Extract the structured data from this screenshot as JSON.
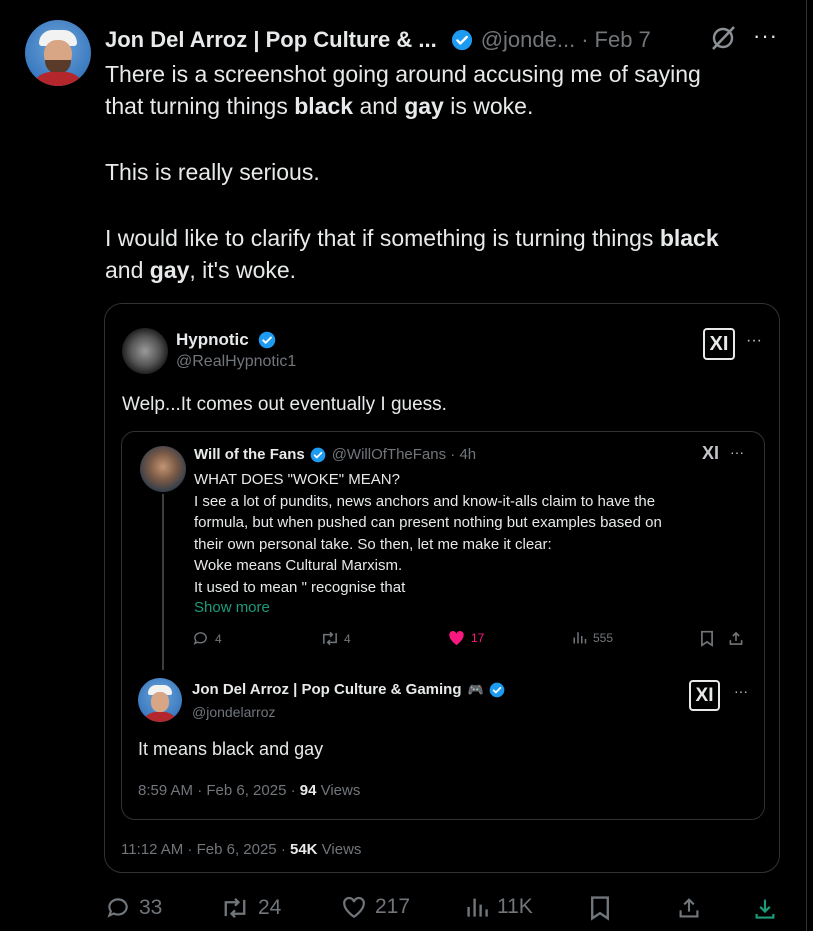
{
  "tweet": {
    "author_name": "Jon Del Arroz | Pop Culture & ...",
    "author_handle": "@jonde...",
    "separator": "·",
    "date": "Feb 7",
    "more": "···",
    "text": {
      "l1_pre": "There is a screenshot going around accusing me of saying",
      "l2_pre": "that turning things ",
      "l2_b1": "black",
      "l2_mid": " and ",
      "l2_b2": "gay",
      "l2_post": " is woke.",
      "p2": "This is really serious.",
      "l5_pre": "I would like to clarify that if something is turning things ",
      "l5_b": "black",
      "l6_mid": "and ",
      "l6_b": "gay",
      "l6_post": ", it's woke."
    }
  },
  "quote": {
    "author_name": "Hypnotic",
    "author_handle": "@RealHypnotic1",
    "xlogo": "XI",
    "more": "···",
    "text": "Welp...It comes out eventually I guess.",
    "nested": {
      "author_name": "Will of the Fans",
      "author_handle": "@WillOfTheFans · 4h",
      "xlogo": "XI",
      "more": "···",
      "lines": [
        "WHAT DOES \"WOKE\" MEAN?",
        "I see a lot of pundits, news anchors and know-it-alls claim to have the",
        "formula, but when pushed can present nothing but examples based on",
        "their own personal take. So then, let me make it clear:",
        "Woke means Cultural Marxism.",
        "It used to mean \" recognise that"
      ],
      "show_more": "Show more",
      "stats": {
        "replies": "4",
        "reposts": "4",
        "likes": "17",
        "views": "555"
      },
      "reply": {
        "author_name": "Jon Del Arroz | Pop Culture & Gaming",
        "emoji": "🎮",
        "author_handle": "@jondelarroz",
        "xlogo": "XI",
        "more": "···",
        "text": "It means black and gay",
        "meta_prefix": "8:59 AM · Feb 6, 2025 · ",
        "views_count": "94",
        "views_label": " Views"
      }
    },
    "meta_prefix": "11:12 AM · Feb 6, 2025 · ",
    "views_count": "54K",
    "views_label": " Views"
  },
  "actions": {
    "replies": "33",
    "reposts": "24",
    "likes": "217",
    "views": "11K"
  },
  "colors": {
    "verified": "#1d9bf0",
    "like": "#f91880",
    "muted": "#71767b",
    "show_more": "#1d9b7a"
  }
}
